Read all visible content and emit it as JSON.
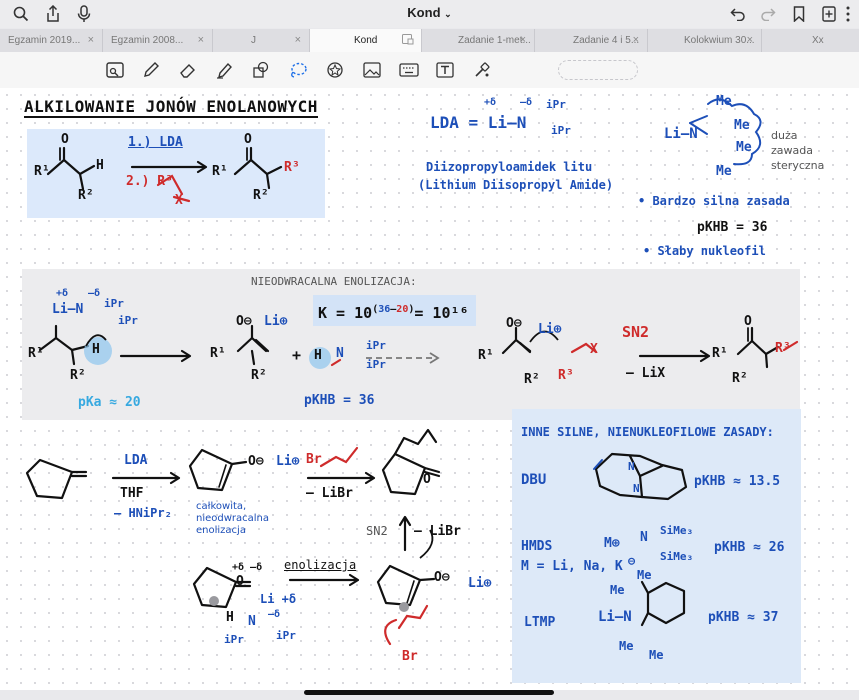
{
  "app": {
    "title": "Kond",
    "toolbar_top_icons": [
      "search-icon",
      "share-icon",
      "mic-icon",
      "undo-icon",
      "redo-icon",
      "bookmark-icon",
      "add-page-icon",
      "more-icon"
    ]
  },
  "tabs": [
    {
      "label": "Egzamin 2019...",
      "close": "×"
    },
    {
      "label": "Egzamin 2008...",
      "close": "×"
    },
    {
      "label": "J",
      "close": "×"
    },
    {
      "label": "Kond",
      "close": "",
      "active": true
    },
    {
      "label": "Zadanie 1-met...",
      "close": "×"
    },
    {
      "label": "Zadanie 4 i 5...",
      "close": "×"
    },
    {
      "label": "Kolokwium 30...",
      "close": "×"
    },
    {
      "label": "Xx",
      "close": ""
    }
  ],
  "tools": [
    "read-mode-icon",
    "pen-icon",
    "eraser-icon",
    "highlighter-icon",
    "shapes-icon",
    "lasso-icon",
    "sticker-icon",
    "image-icon",
    "keyboard-icon",
    "textbox-icon",
    "laser-icon"
  ],
  "colors": {
    "black": "#111111",
    "blue": "#1d4fb8",
    "red": "#cf2b2b",
    "cyan": "#37a9e0",
    "highlight": "#d6e6fa"
  },
  "notes": {
    "title": "ALKILOWANIE JONÓW ENOLANOWYCH",
    "step1": "1.) LDA",
    "step2": "2.) R³",
    "lda_eq": "LDA = Li–N",
    "lda_sub": "iPr",
    "delta_plus": "+δ",
    "delta_minus": "–δ",
    "lda_name": "Diizopropyloamidek litu",
    "lda_name_en": "(Lithium Diisopropyl Amide)",
    "hindrance": "duża zawada steryczna",
    "me": "Me",
    "bullet1": "• Bardzo silna zasada",
    "pkhb_36": "pKHB = 36",
    "bullet2": "• Słaby nukleofil",
    "irreversible": "NIEODWRACALNA ENOLIZACJA:",
    "k_label": "K = 10",
    "k_exp_a": "36",
    "k_exp_b": "20",
    "k_result": "= 10¹⁶",
    "pka": "pKa ≈ 20",
    "pkhb": "pKHB = 36",
    "sn2": "SN2",
    "minus_lix": "– LiX",
    "lda2": "LDA",
    "thf": "THF",
    "minus_hnipr2": "– HNiPr₂",
    "complete": "całkowita, nieodwracalna enolizacja",
    "br_reagent": "Br",
    "minus_libr": "– LiBr",
    "enolizacja": "enolizacja",
    "li_plus": "Li⊕",
    "o_minus": "O⊖",
    "h": "H",
    "r1": "R¹",
    "r2": "R²",
    "r3": "R³",
    "x": "X",
    "ipr": "iPr",
    "li_delta": "Li +δ",
    "other_bases": "INNE SILNE, NIENUKLEOFILOWE ZASADY:",
    "dbu": "DBU",
    "dbu_pk": "pKHB ≈ 13.5",
    "hmds": "HMDS",
    "hmds_m": "M = Li, Na, K",
    "hmds_pk": "pKHB ≈ 26",
    "sime3": "SiMe₃",
    "ltmp": "LTMP",
    "ltmp_pk": "pKHB ≈ 37",
    "li_n": "Li–N"
  }
}
